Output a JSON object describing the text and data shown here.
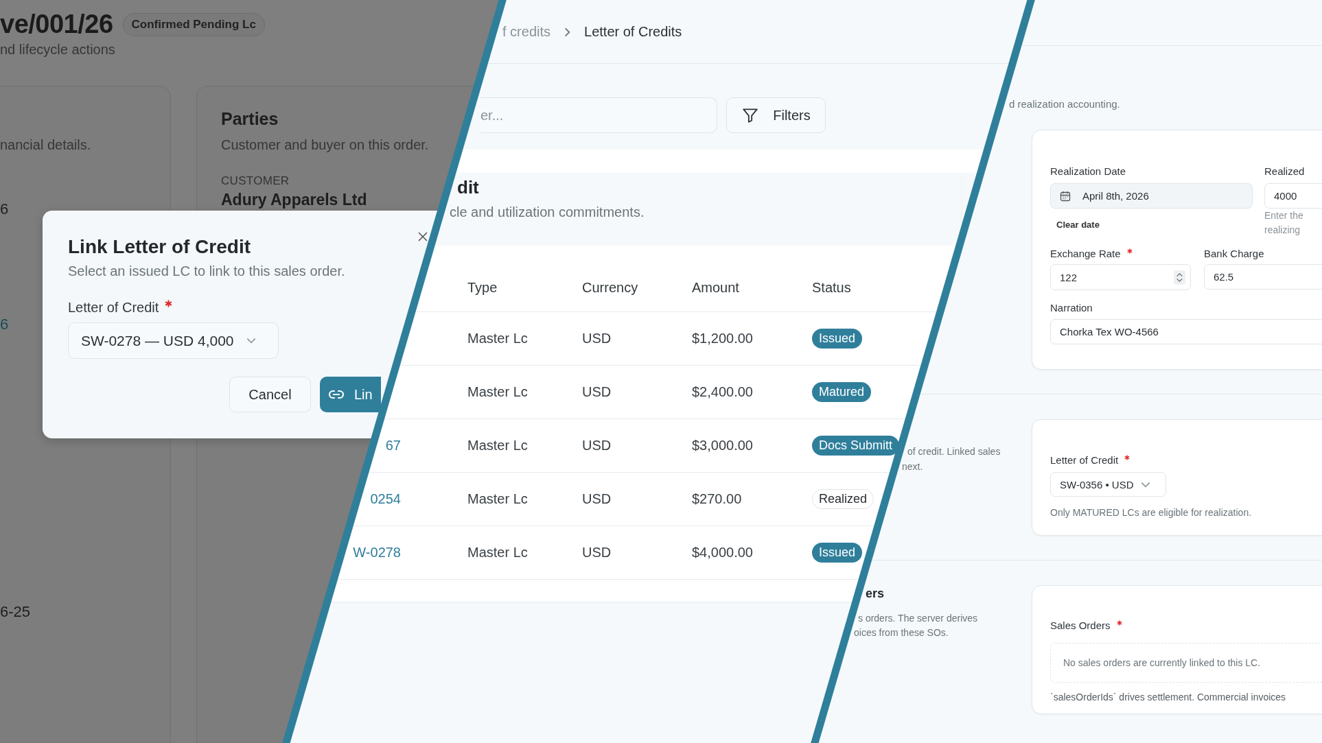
{
  "background_page": {
    "title": "ve/001/26",
    "status_badge": "Confirmed Pending Lc",
    "subtitle": "nd lifecycle actions",
    "details_card": {
      "description": "nancial details.",
      "values": [
        {
          "text": "6",
          "kind": "plain"
        },
        {
          "text": "6",
          "kind": "link"
        },
        {
          "text": "6-25",
          "kind": "plain"
        }
      ]
    },
    "parties_card": {
      "title": "Parties",
      "description": "Customer and buyer on this order.",
      "customer_label": "CUSTOMER",
      "customer_name": "Adury Apparels Ltd"
    }
  },
  "dialog": {
    "title": "Link Letter of Credit",
    "description": "Select an issued LC to link to this sales order.",
    "field": {
      "label": "Letter of Credit",
      "required": true,
      "value": "SW-0278 — USD 4,000"
    },
    "buttons": [
      {
        "label": "Cancel",
        "kind": "secondary"
      },
      {
        "label": "Lin",
        "kind": "primary"
      }
    ]
  },
  "lc_list": {
    "breadcrumb": [
      "f credits",
      "Letter of Credits"
    ],
    "search": {
      "placeholder": "er..."
    },
    "filters_button": "Filters",
    "card": {
      "title": "dit",
      "description": "cle and utilization commitments."
    },
    "table": {
      "columns": [
        "Type",
        "Currency",
        "Amount",
        "Status"
      ],
      "rows": [
        {
          "type": "Master Lc",
          "currency": "USD",
          "amount": "$1,200.00",
          "status": {
            "label": "Issued",
            "kind": "filled"
          }
        },
        {
          "type": "Master Lc",
          "currency": "USD",
          "amount": "$2,400.00",
          "status": {
            "label": "Matured",
            "kind": "filled"
          }
        },
        {
          "reference": "67",
          "type": "Master Lc",
          "currency": "USD",
          "amount": "$3,000.00",
          "status": {
            "label": "Docs Submitt",
            "kind": "filled"
          }
        },
        {
          "reference": "0254",
          "type": "Master Lc",
          "currency": "USD",
          "amount": "$270.00",
          "status": {
            "label": "Realized",
            "kind": "outline"
          }
        },
        {
          "reference": "W-0278",
          "type": "Master Lc",
          "currency": "USD",
          "amount": "$4,000.00",
          "status": {
            "label": "Issued",
            "kind": "filled"
          }
        }
      ]
    }
  },
  "realization": {
    "intro": "d realization accounting.",
    "details_card": {
      "realization_date": {
        "label": "Realization Date",
        "required": false,
        "value": "April 8th, 2026",
        "clear_link": "Clear date"
      },
      "realized_amount": {
        "label": "Realized",
        "required": false,
        "value": "4000",
        "hint": [
          "Enter the",
          "realizing"
        ]
      },
      "exchange_rate": {
        "label": "Exchange Rate",
        "required": true,
        "value": "122"
      },
      "bank_charge": {
        "label": "Bank Charge",
        "required": false,
        "value": "62.5"
      },
      "narration": {
        "label": "Narration",
        "required": false,
        "value": "Chorka Tex WO-4566"
      }
    },
    "lc_section": {
      "description": [
        "of credit. Linked sales",
        "next."
      ],
      "field": {
        "label": "Letter of Credit",
        "required": true,
        "value": "SW-0356 • USD"
      },
      "hint": "Only MATURED LCs are eligible for realization."
    },
    "sales_orders_section": {
      "title": "ers",
      "description": [
        "s orders. The server derives",
        "oices from these SOs."
      ],
      "field": {
        "label": "Sales Orders",
        "required": true
      },
      "empty_message": "No sales orders are currently linked to this LC.",
      "hint": "`salesOrderIds` drives settlement. Commercial invoices"
    }
  }
}
